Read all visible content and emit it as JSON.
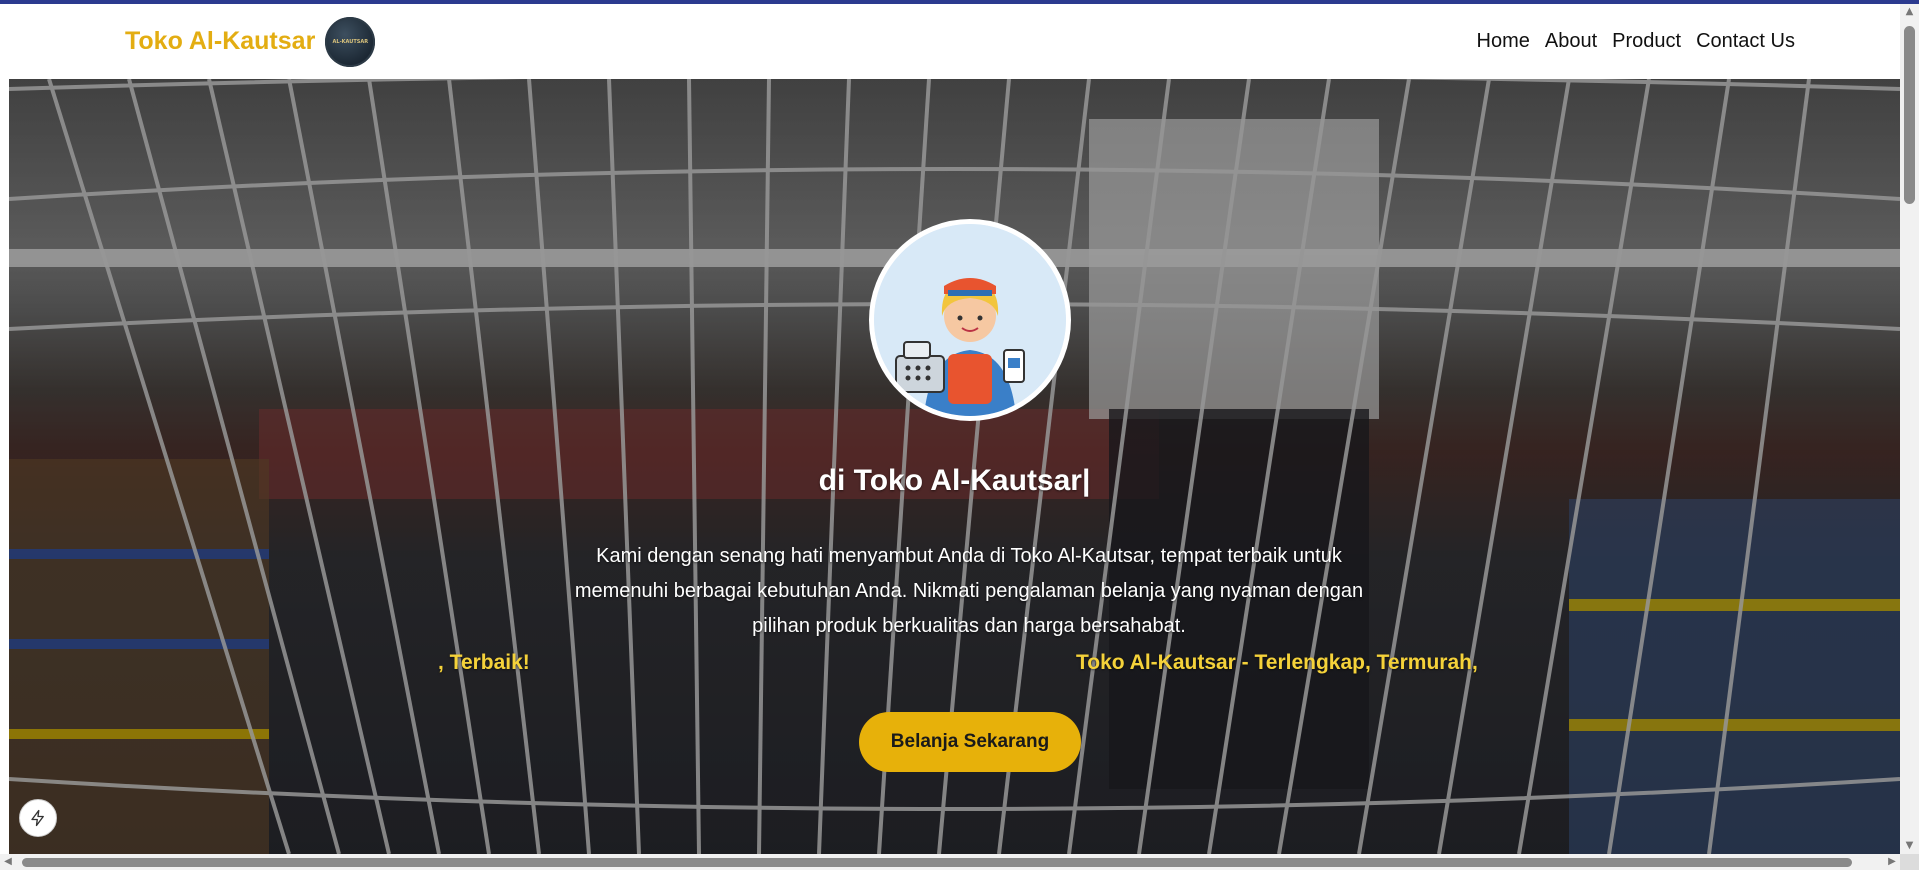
{
  "brand": {
    "name": "Toko Al-Kautsar",
    "logo_text": "AL-KAUTSAR"
  },
  "nav": {
    "items": [
      "Home",
      "About",
      "Product",
      "Contact Us"
    ]
  },
  "hero": {
    "heading": "di Toko Al-Kautsar|",
    "description": "Kami dengan senang hati menyambut Anda di Toko Al-Kautsar, tempat terbaik untuk memenuhi berbagai kebutuhan Anda. Nikmati pengalaman belanja yang nyaman dengan pilihan produk berkualitas dan harga bersahabat.",
    "marquee_left": ", Terbaik!",
    "marquee_right": "Toko Al-Kautsar - Terlengkap, Termurah,",
    "cta_label": "Belanja Sekarang"
  },
  "colors": {
    "accent": "#e7b10a",
    "brand": "#e3ad12",
    "top_bar": "#2b3a8f",
    "marquee": "#f5d23a"
  },
  "icons": {
    "cashier": "cashier-illustration",
    "fab": "lightning-icon"
  }
}
